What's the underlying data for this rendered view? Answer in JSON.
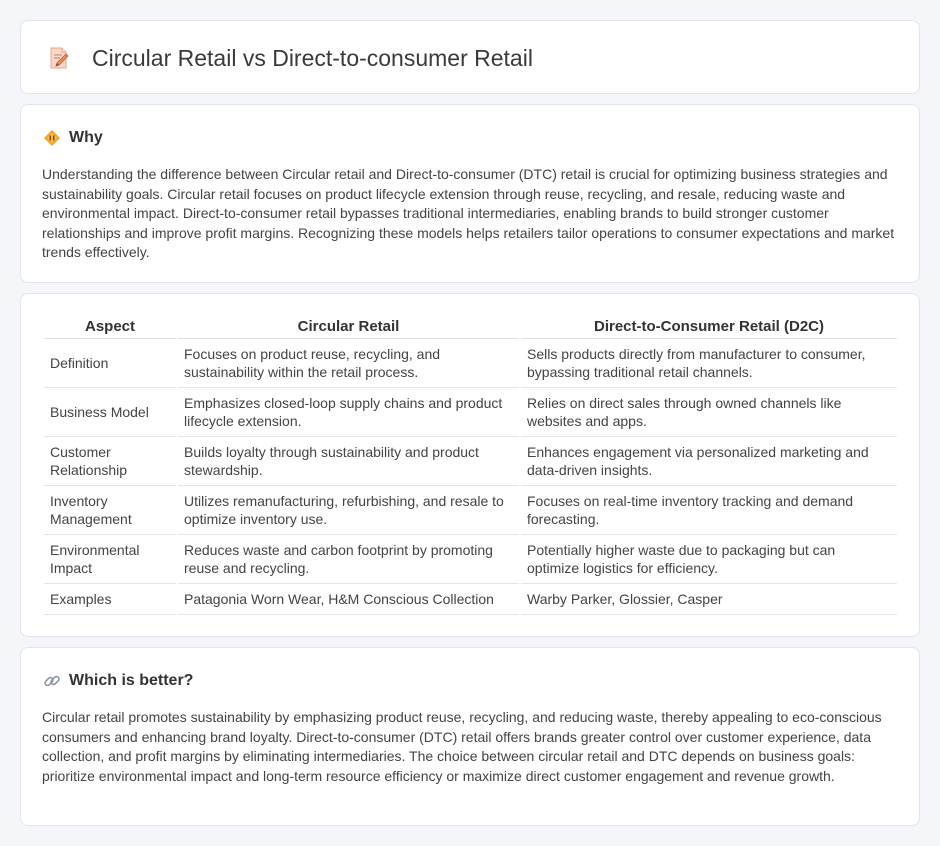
{
  "header": {
    "title": "Circular Retail vs Direct-to-consumer Retail",
    "icon": "document-pencil-icon"
  },
  "why": {
    "title": "Why",
    "icon": "diamond-icon",
    "text": "Understanding the difference between Circular retail and Direct-to-consumer (DTC) retail is crucial for optimizing business strategies and sustainability goals. Circular retail focuses on product lifecycle extension through reuse, recycling, and resale, reducing waste and environmental impact. Direct-to-consumer retail bypasses traditional intermediaries, enabling brands to build stronger customer relationships and improve profit margins. Recognizing these models helps retailers tailor operations to consumer expectations and market trends effectively."
  },
  "table": {
    "headers": [
      "Aspect",
      "Circular Retail",
      "Direct-to-Consumer Retail (D2C)"
    ],
    "rows": [
      [
        "Definition",
        "Focuses on product reuse, recycling, and sustainability within the retail process.",
        "Sells products directly from manufacturer to consumer, bypassing traditional retail channels."
      ],
      [
        "Business Model",
        "Emphasizes closed-loop supply chains and product lifecycle extension.",
        "Relies on direct sales through owned channels like websites and apps."
      ],
      [
        "Customer Relationship",
        "Builds loyalty through sustainability and product stewardship.",
        "Enhances engagement via personalized marketing and data-driven insights."
      ],
      [
        "Inventory Management",
        "Utilizes remanufacturing, refurbishing, and resale to optimize inventory use.",
        "Focuses on real-time inventory tracking and demand forecasting."
      ],
      [
        "Environmental Impact",
        "Reduces waste and carbon footprint by promoting reuse and recycling.",
        "Potentially higher waste due to packaging but can optimize logistics for efficiency."
      ],
      [
        "Examples",
        "Patagonia Worn Wear, H&M Conscious Collection",
        "Warby Parker, Glossier, Casper"
      ]
    ]
  },
  "better": {
    "title": "Which is better?",
    "icon": "link-icon",
    "text": "Circular retail promotes sustainability by emphasizing product reuse, recycling, and reducing waste, thereby appealing to eco-conscious consumers and enhancing brand loyalty. Direct-to-consumer (DTC) retail offers brands greater control over customer experience, data collection, and profit margins by eliminating intermediaries. The choice between circular retail and DTC depends on business goals: prioritize environmental impact and long-term resource efficiency or maximize direct customer engagement and revenue growth."
  }
}
